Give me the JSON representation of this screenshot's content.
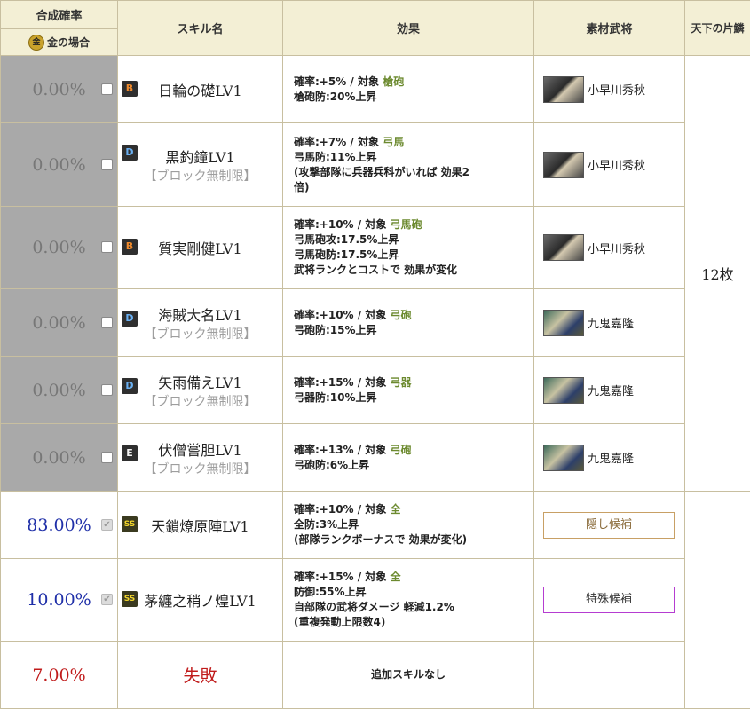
{
  "header": {
    "rate_title": "合成確率",
    "gold_icon": "金",
    "gold_case": "金の場合",
    "skill_name": "スキル名",
    "effect": "効果",
    "material": "素材武将",
    "side_title": "天下の片鱗"
  },
  "side_count": "12枚",
  "rows": [
    {
      "rate": "0.00%",
      "checked": false,
      "grade": "B",
      "name": "日輪の礎LV1",
      "note": "",
      "effect": {
        "prob": "確率:+5%",
        "target_label": "対象",
        "target": "槍砲",
        "lines": [
          "槍砲防:20%上昇"
        ]
      },
      "material": {
        "name": "小早川秀秋",
        "portrait": "portrait-icon"
      }
    },
    {
      "rate": "0.00%",
      "checked": false,
      "grade": "D",
      "name": "黒釣鐘LV1",
      "note": "【ブロック無制限】",
      "effect": {
        "prob": "確率:+7%",
        "target_label": "対象",
        "target": "弓馬",
        "lines": [
          "弓馬防:11%上昇",
          "(攻撃部隊に兵器兵科がいれば 効果2",
          "倍)"
        ]
      },
      "material": {
        "name": "小早川秀秋",
        "portrait": "portrait-icon"
      }
    },
    {
      "rate": "0.00%",
      "checked": false,
      "grade": "B",
      "name": "質実剛健LV1",
      "note": "",
      "effect": {
        "prob": "確率:+10%",
        "target_label": "対象",
        "target": "弓馬砲",
        "lines": [
          "弓馬砲攻:17.5%上昇",
          "弓馬砲防:17.5%上昇",
          "武将ランクとコストで 効果が変化"
        ]
      },
      "material": {
        "name": "小早川秀秋",
        "portrait": "portrait-icon"
      }
    },
    {
      "rate": "0.00%",
      "checked": false,
      "grade": "D",
      "name": "海賊大名LV1",
      "note": "【ブロック無制限】",
      "effect": {
        "prob": "確率:+10%",
        "target_label": "対象",
        "target": "弓砲",
        "lines": [
          "弓砲防:15%上昇"
        ]
      },
      "material": {
        "name": "九鬼嘉隆",
        "portrait": "portrait-icon"
      }
    },
    {
      "rate": "0.00%",
      "checked": false,
      "grade": "D",
      "name": "矢雨備えLV1",
      "note": "【ブロック無制限】",
      "effect": {
        "prob": "確率:+15%",
        "target_label": "対象",
        "target": "弓器",
        "lines": [
          "弓器防:10%上昇"
        ]
      },
      "material": {
        "name": "九鬼嘉隆",
        "portrait": "portrait-icon"
      }
    },
    {
      "rate": "0.00%",
      "checked": false,
      "grade": "E",
      "name": "伏僧嘗胆LV1",
      "note": "【ブロック無制限】",
      "effect": {
        "prob": "確率:+13%",
        "target_label": "対象",
        "target": "弓砲",
        "lines": [
          "弓砲防:6%上昇"
        ]
      },
      "material": {
        "name": "九鬼嘉隆",
        "portrait": "portrait-icon"
      }
    },
    {
      "rate": "83.00%",
      "checked": true,
      "grade": "SS",
      "name": "天鎖燎原陣LV1",
      "note": "",
      "effect": {
        "prob": "確率:+10%",
        "target_label": "対象",
        "target": "全",
        "lines": [
          "全防:3%上昇",
          "(部隊ランクボーナスで 効果が変化)"
        ]
      },
      "candidate": "隠し候補"
    },
    {
      "rate": "10.00%",
      "checked": true,
      "grade": "SS",
      "name": "茅纏之稍ノ煌LV1",
      "note": "",
      "effect": {
        "prob": "確率:+15%",
        "target_label": "対象",
        "target": "全",
        "lines": [
          "防御:55%上昇",
          "自部隊の武将ダメージ 軽減1.2%",
          "(重複発動上限数4)"
        ]
      },
      "candidate": "特殊候補"
    }
  ],
  "fail_row": {
    "rate": "7.00%",
    "name": "失敗",
    "effect": "追加スキルなし"
  },
  "colors": {
    "header_bg": "#f3efd5",
    "gray_cell": "#a9a9a9",
    "rate_blue": "#1f2fa8",
    "fail_red": "#c01b1b",
    "target_green": "#6c8a2f"
  }
}
